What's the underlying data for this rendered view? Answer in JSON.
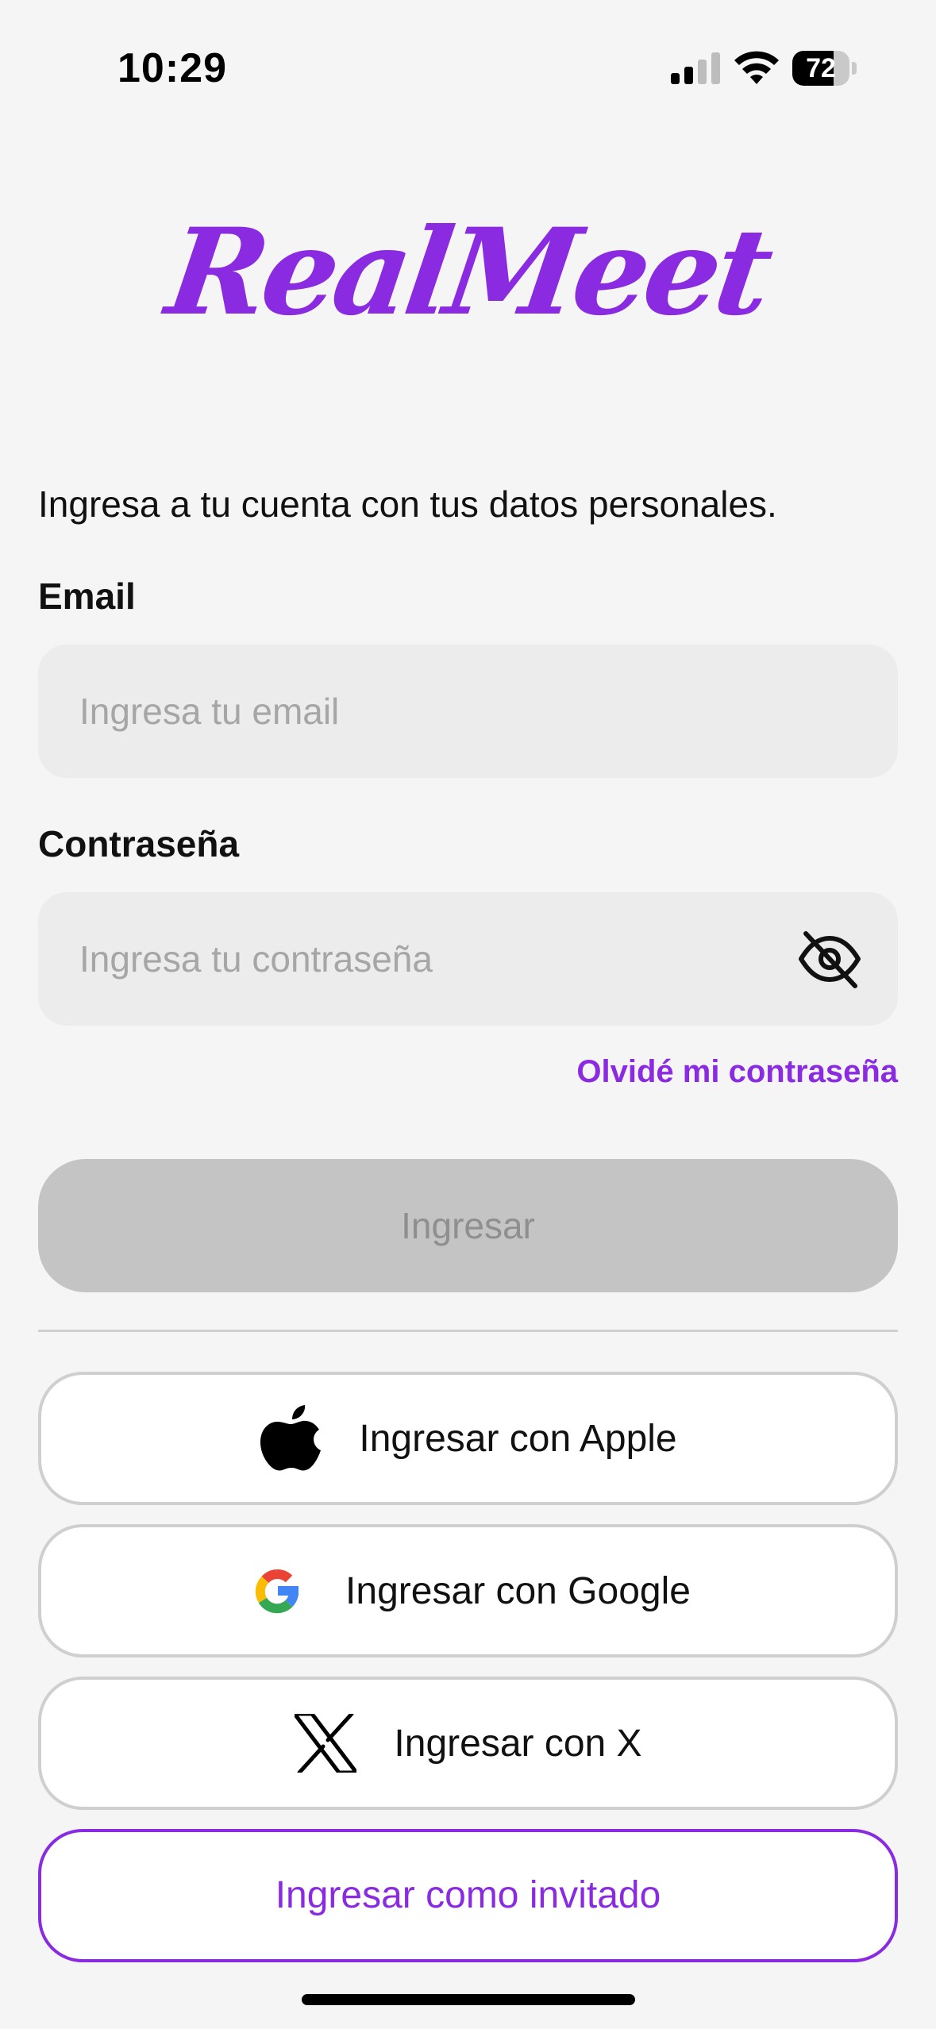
{
  "status_bar": {
    "time": "10:29",
    "battery_percent": "72",
    "battery_level": 0.72
  },
  "logo": {
    "text": "RealMeet"
  },
  "login": {
    "subtitle": "Ingresa a tu cuenta con tus datos personales.",
    "email_label": "Email",
    "email_placeholder": "Ingresa tu email",
    "password_label": "Contraseña",
    "password_placeholder": "Ingresa tu contraseña",
    "forgot_password": "Olvidé mi contraseña",
    "submit_label": "Ingresar"
  },
  "social": {
    "apple_label": "Ingresar con Apple",
    "google_label": "Ingresar con Google",
    "x_label": "Ingresar con X",
    "guest_label": "Ingresar como invitado"
  },
  "icons": {
    "apple": "apple-icon",
    "google": "google-icon",
    "x": "x-icon",
    "eye": "eye-off-icon"
  },
  "colors": {
    "accent": "#8a2be2",
    "disabled_button": "#c4c4c4",
    "field_background": "#ececec"
  }
}
